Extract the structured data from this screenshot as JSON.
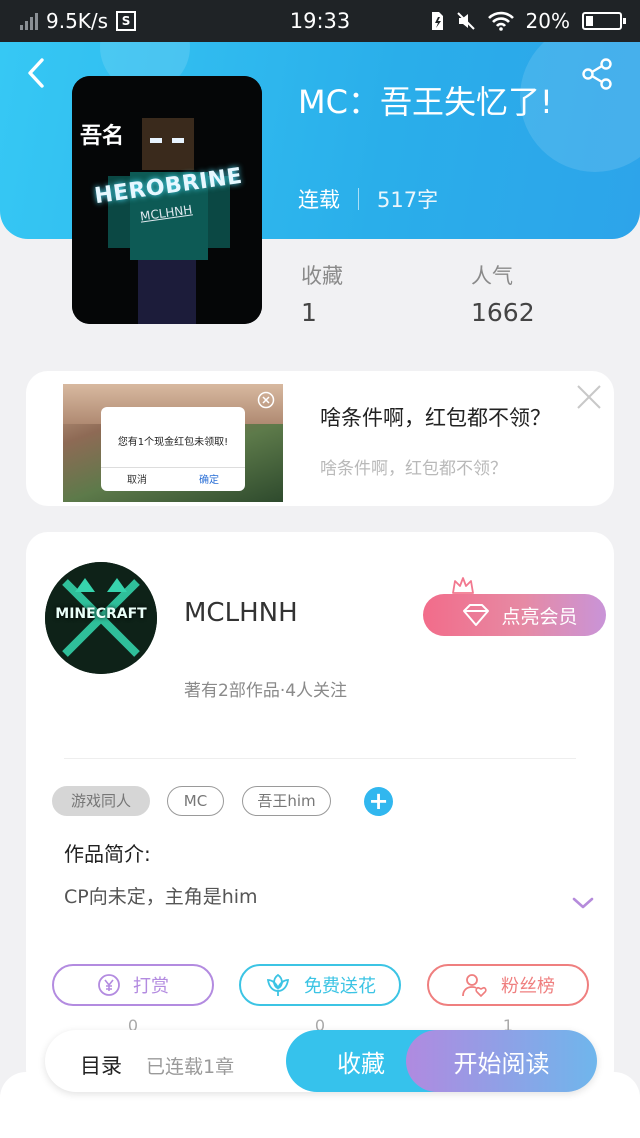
{
  "status_bar": {
    "speed": "9.5K/s",
    "s_badge": "S",
    "time": "19:33",
    "battery": "20%",
    "battery_level": 0.2
  },
  "book": {
    "title": "MC：吾王失忆了!",
    "status": "连载",
    "word_count": "517字",
    "cover": {
      "text_top": "吾名",
      "text_main": "HEROBRINE",
      "text_sub": "MCLHNH"
    }
  },
  "stats": [
    {
      "label": "收藏",
      "value": "1"
    },
    {
      "label": "人气",
      "value": "1662"
    }
  ],
  "ad": {
    "title": "啥条件啊，红包都不领？",
    "subtitle": "啥条件啊，红包都不领？",
    "dialog_text": "您有1个现金红包未领取!",
    "dialog_cancel": "取消",
    "dialog_confirm": "确定"
  },
  "author": {
    "name": "MCLHNH",
    "meta": "著有2部作品·4人关注",
    "avatar_text": "MINECRAFT",
    "vip_label": "点亮会员"
  },
  "tags": [
    "游戏同人",
    "MC",
    "吾王him"
  ],
  "intro": {
    "title": "作品简介:",
    "text": "CP向未定，主角是him"
  },
  "actions": [
    {
      "label": "打赏",
      "count": "0",
      "color": "#b38be0"
    },
    {
      "label": "免费送花",
      "count": "0",
      "color": "#3cc4e4"
    },
    {
      "label": "粉丝榜",
      "count": "1",
      "color": "#ef7f7f"
    }
  ],
  "bottom": {
    "toc_label": "目录",
    "toc_sub": "已连载1章",
    "fav_label": "收藏",
    "read_label": "开始阅读"
  },
  "colors": {
    "header": "#2aaeea",
    "accent": "#36c2ec",
    "vip_start": "#f26c8a",
    "vip_end": "#c994d8"
  }
}
